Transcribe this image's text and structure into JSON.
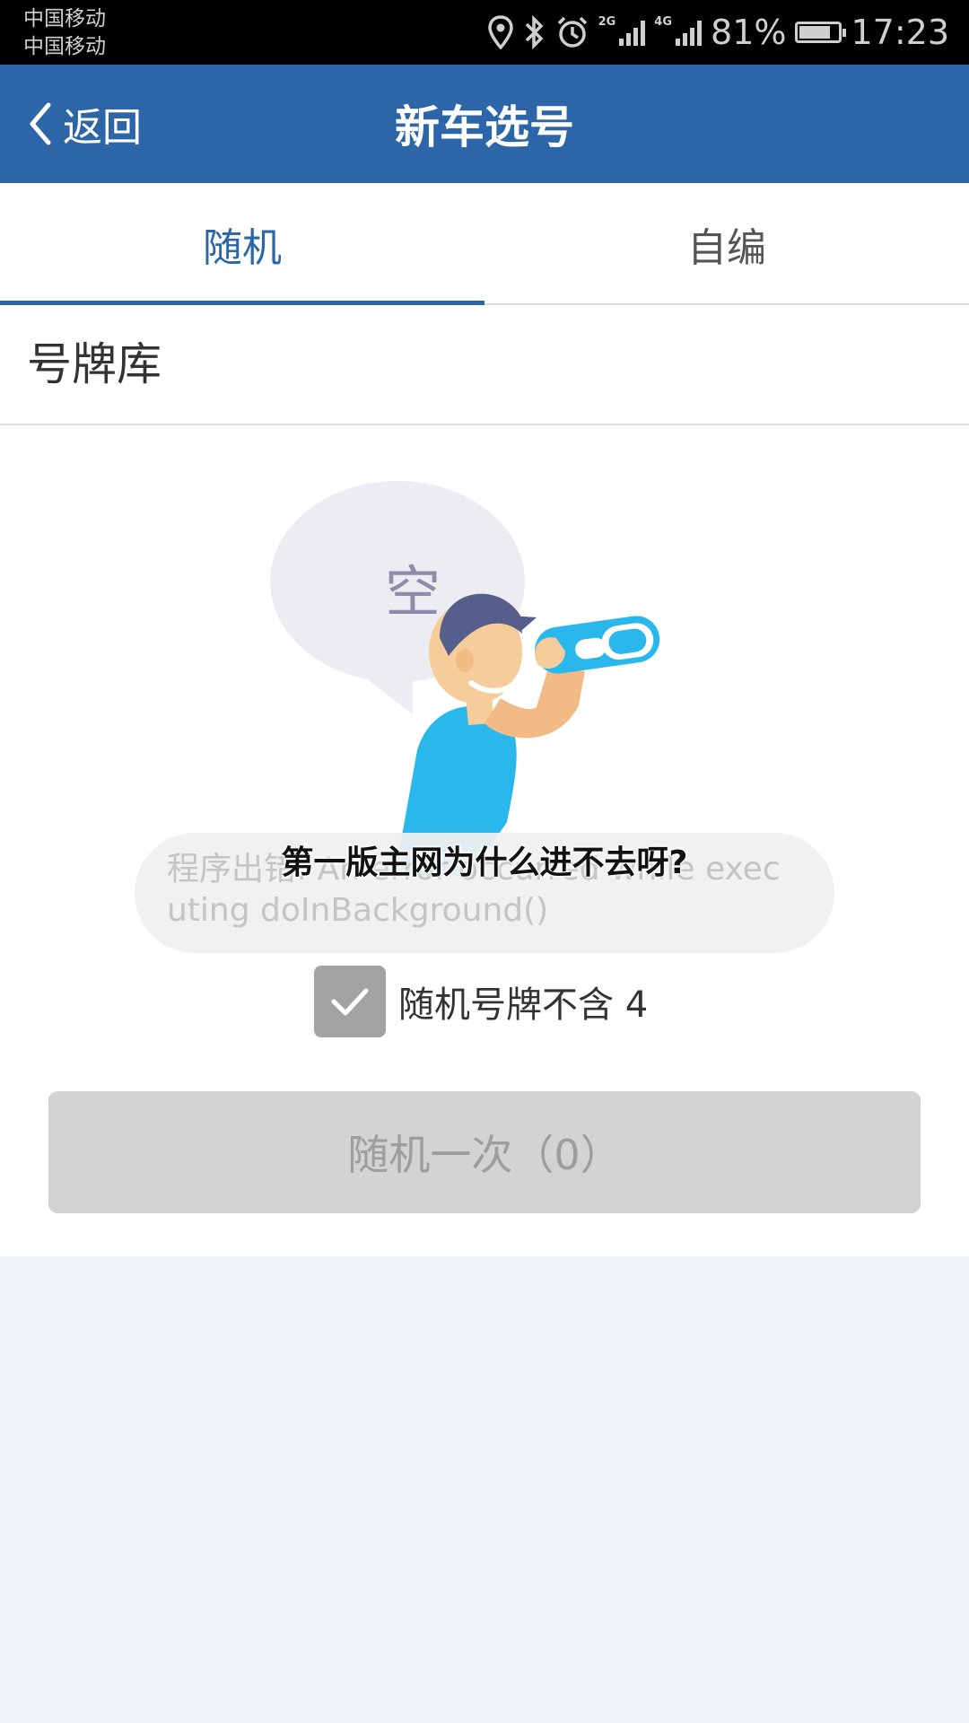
{
  "status_bar": {
    "carriers": [
      "中国移动",
      "中国移动"
    ],
    "network_1": "2G",
    "network_2": "4G",
    "battery_percent": "81%",
    "battery_level": 0.81,
    "time": "17:23",
    "icons": [
      "location-icon",
      "bluetooth-icon",
      "alarm-icon",
      "signal-icon",
      "battery-icon"
    ]
  },
  "navbar": {
    "back_label": "返回",
    "title": "新车选号",
    "background": "#2d66a8"
  },
  "tabs": [
    {
      "label": "随机",
      "active": true
    },
    {
      "label": "自编",
      "active": false
    }
  ],
  "section": {
    "title": "号牌库"
  },
  "empty_state": {
    "bubble_text": "空"
  },
  "toast": {
    "message": "程序出错: An error occurred while executing doInBackground()"
  },
  "overlay_caption": "第一版主网为什么进不去呀?",
  "option": {
    "label": "随机号牌不含 4",
    "checked": true
  },
  "random_button": {
    "label": "随机一次（0）",
    "enabled": false
  },
  "colors": {
    "accent": "#2d66a8",
    "page_background": "#f3f6f8",
    "disabled_button": "#d3d3d3"
  }
}
